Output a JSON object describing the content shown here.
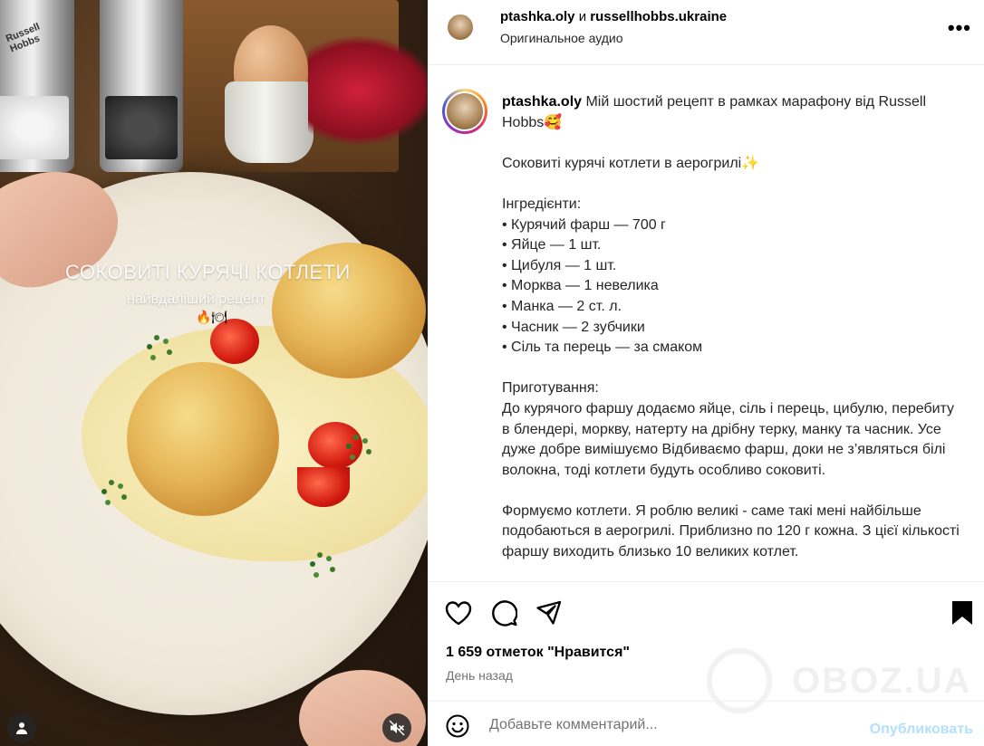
{
  "media": {
    "overlay_title": "СОКОВИТІ КУРЯЧІ КОТЛЕТИ",
    "overlay_subtitle": "найвдаліший рецепт",
    "overlay_emoji": "🔥🍽",
    "grinder_brand": "Russell\nHobbs"
  },
  "header": {
    "author": "ptashka.oly",
    "and": " и ",
    "coauthor": "russellhobbs.ukraine",
    "audio": "Оригинальное аудио",
    "more_glyph": "•••"
  },
  "caption": {
    "username": "ptashka.oly",
    "text": " Мій шостий рецепт в рамках марафону від Russell Hobbs🥰\n\nСоковиті курячі котлети в аерогрилі✨\n\nІнгредієнти:\n• Курячий фарш — 700 г\n• Яйце — 1 шт.\n• Цибуля — 1 шт.\n• Морква — 1 невелика\n• Манка — 2 ст. л.\n• Часник — 2 зубчики\n• Сіль та перець — за смаком\n\nПриготування:\nДо курячого фаршу додаємо яйце, сіль і перець, цибулю, перебиту в блендері, моркву, натерту на дрібну терку, манку та часник. Усе дуже добре вимішуємо Відбиваємо фарш, доки не з’являться білі волокна, тоді котлети будуть особливо соковиті.\n\nФормуємо котлети. Я роблю великі - саме такі мені найбільше подобаються в аерогрилі. Приблизно по 120 г кожна. З цієї кількості фаршу виходить близько 10 великих котлет."
  },
  "stats": {
    "likes": "1 659 отметок \"Нравится\"",
    "date": "День назад"
  },
  "watermark": "OBOZ.UA",
  "comment": {
    "placeholder": "Добавьте комментарий...",
    "post_label": "Опубликовать"
  }
}
